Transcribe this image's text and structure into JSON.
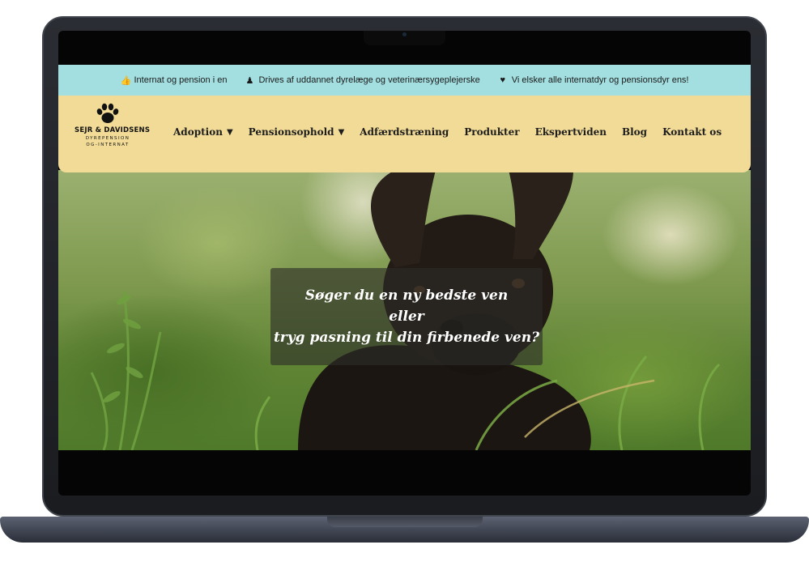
{
  "topbar": {
    "items": [
      {
        "icon": "thumbs-up-icon",
        "glyph": "👍",
        "label": "Internat og pension i en"
      },
      {
        "icon": "person-icon",
        "glyph": "♟",
        "label": "Drives af uddannet dyrelæge og veterinærsygeplejerske"
      },
      {
        "icon": "heart-icon",
        "glyph": "♥",
        "label": "Vi elsker alle internatdyr og pensionsdyr ens!"
      }
    ]
  },
  "logo": {
    "icon": "paw-icon",
    "name": "SEJR & DAVIDSENS",
    "line1": "DYREPENSION",
    "line2": "OG-INTERNAT"
  },
  "nav": {
    "items": [
      {
        "label": "Adoption",
        "caret": "▼"
      },
      {
        "label": "Pensionsophold",
        "caret": "▼"
      },
      {
        "label": "Adfærdstræning"
      },
      {
        "label": "Produkter"
      },
      {
        "label": "Ekspertviden"
      },
      {
        "label": "Blog"
      },
      {
        "label": "Kontakt os"
      }
    ]
  },
  "hero": {
    "line1": "Søger du en ny bedste ven",
    "line2": "eller",
    "line3": "tryg pasning til din firbenede ven?"
  },
  "colors": {
    "topbar": "#a3dfe0",
    "navbar": "#f1db97",
    "laptop_frame": "#1f2126",
    "laptop_base": "#4b5060"
  }
}
